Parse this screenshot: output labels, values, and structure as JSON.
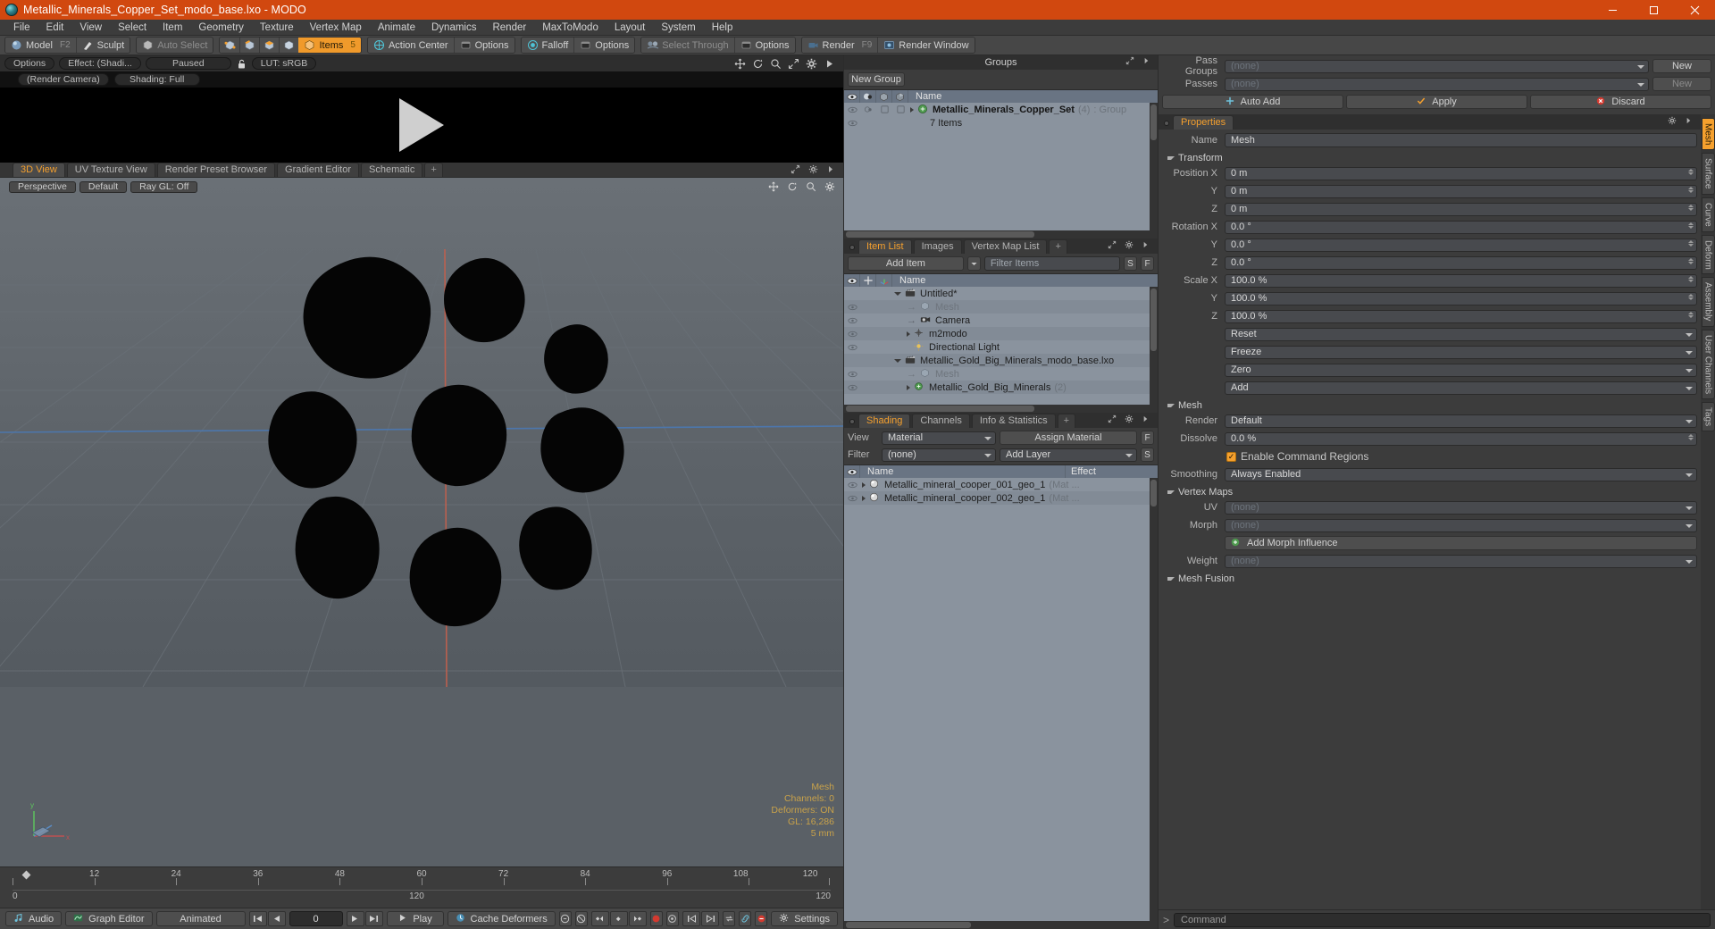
{
  "window": {
    "title": "Metallic_Minerals_Copper_Set_modo_base.lxo - MODO",
    "minimize": "─",
    "maximize": "❐",
    "close": "✕"
  },
  "menubar": [
    "File",
    "Edit",
    "View",
    "Select",
    "Item",
    "Geometry",
    "Texture",
    "Vertex Map",
    "Animate",
    "Dynamics",
    "Render",
    "MaxToModo",
    "Layout",
    "System",
    "Help"
  ],
  "toolbar": {
    "mode_model": "Model",
    "mode_model_key": "F2",
    "mode_sculpt": "Sculpt",
    "auto_select": "Auto Select",
    "items": "Items",
    "items_key": "5",
    "action_center": "Action Center",
    "options1": "Options",
    "falloff": "Falloff",
    "options2": "Options",
    "select_through": "Select Through",
    "options3": "Options",
    "render": "Render",
    "render_key": "F9",
    "render_window": "Render Window"
  },
  "preview": {
    "options": "Options",
    "effect": "Effect: (Shadi...",
    "paused": "Paused",
    "lut": "LUT: sRGB",
    "render_camera": "(Render Camera)",
    "shading": "Shading: Full"
  },
  "viewport_tabs": [
    {
      "label": "3D View",
      "active": true
    },
    {
      "label": "UV Texture View",
      "active": false
    },
    {
      "label": "Render Preset Browser",
      "active": false
    },
    {
      "label": "Gradient Editor",
      "active": false
    },
    {
      "label": "Schematic",
      "active": false
    },
    {
      "label": "+",
      "active": false
    }
  ],
  "viewport": {
    "perspective": "Perspective",
    "default": "Default",
    "raygl": "Ray GL: Off",
    "stats": {
      "title": "Mesh",
      "channels": "Channels: 0",
      "deformers": "Deformers: ON",
      "gl": "GL: 16,286",
      "size": "5 mm"
    },
    "axis_y": "y",
    "axis_x": "x",
    "axis_z": "z"
  },
  "timeline": {
    "ticks": [
      "0",
      "12",
      "24",
      "36",
      "48",
      "60",
      "72",
      "84",
      "96",
      "108",
      "120"
    ],
    "left_value": "0",
    "center_value": "120",
    "right_value": "120"
  },
  "statusbar": {
    "audio": "Audio",
    "graph_editor": "Graph Editor",
    "animated": "Animated",
    "frame": "0",
    "play": "Play",
    "cache_deformers": "Cache Deformers",
    "settings": "Settings"
  },
  "groups_panel": {
    "title": "Groups",
    "new_group": "New Group",
    "columns": [
      "eye",
      "shade",
      "render",
      "lock",
      "Name"
    ],
    "name_column": "Name",
    "rows": [
      {
        "name": "Metallic_Minerals_Copper_Set",
        "count": "(4)",
        "suffix": ": Group",
        "sub": "7 Items"
      }
    ]
  },
  "item_list_panel": {
    "tabs": [
      {
        "label": "Item List",
        "active": true
      },
      {
        "label": "Images",
        "active": false
      },
      {
        "label": "Vertex Map List",
        "active": false
      },
      {
        "label": "+",
        "active": false
      }
    ],
    "add_item": "Add Item",
    "filter_placeholder": "Filter Items",
    "btn_s": "S",
    "btn_f": "F",
    "name_column": "Name",
    "rows": [
      {
        "label": "Untitled*",
        "type": "scene",
        "depth": 0,
        "dim": false,
        "expander": "down"
      },
      {
        "label": "Mesh",
        "type": "mesh",
        "depth": 1,
        "dim": true,
        "expander": ""
      },
      {
        "label": "Camera",
        "type": "camera",
        "depth": 1,
        "dim": false,
        "expander": ""
      },
      {
        "label": "m2modo",
        "type": "locator",
        "depth": 1,
        "dim": false,
        "expander": "right"
      },
      {
        "label": "Directional Light",
        "type": "light",
        "depth": 1,
        "dim": false,
        "expander": ""
      },
      {
        "label": "Metallic_Gold_Big_Minerals_modo_base.lxo",
        "type": "scene",
        "depth": 0,
        "dim": false,
        "expander": "down"
      },
      {
        "label": "Mesh",
        "type": "mesh",
        "depth": 1,
        "dim": true,
        "expander": ""
      },
      {
        "label": "Metallic_Gold_Big_Minerals",
        "type": "group",
        "depth": 1,
        "dim": false,
        "expander": "right",
        "count": "(2)"
      }
    ]
  },
  "shading_panel": {
    "tabs": [
      {
        "label": "Shading",
        "active": true
      },
      {
        "label": "Channels",
        "active": false
      },
      {
        "label": "Info & Statistics",
        "active": false
      },
      {
        "label": "+",
        "active": false
      }
    ],
    "view_label": "View",
    "view_value": "Material",
    "assign_material": "Assign Material",
    "btn_f": "F",
    "filter_label": "Filter",
    "filter_value": "(none)",
    "add_layer": "Add Layer",
    "btn_s": "S",
    "col_name": "Name",
    "col_effect": "Effect",
    "rows": [
      {
        "name": "Metallic_mineral_cooper_001_geo_1",
        "suffix": "(Mat ..."
      },
      {
        "name": "Metallic_mineral_cooper_002_geo_1",
        "suffix": "(Mat ..."
      }
    ]
  },
  "passes_panel": {
    "pass_groups_label": "Pass Groups",
    "pass_groups_value": "(none)",
    "new_button": "New",
    "passes_label": "Passes",
    "passes_value": "(none)",
    "new_button2": "New",
    "auto_add": "Auto Add",
    "apply": "Apply",
    "discard": "Discard"
  },
  "properties": {
    "tab_label": "Properties",
    "name_label": "Name",
    "name_value": "Mesh",
    "sections": {
      "transform": "Transform",
      "mesh": "Mesh",
      "vertex_maps": "Vertex Maps",
      "mesh_fusion": "Mesh Fusion"
    },
    "transform": [
      {
        "label": "Position X",
        "value": "0 m"
      },
      {
        "label": "Y",
        "value": "0 m"
      },
      {
        "label": "Z",
        "value": "0 m"
      },
      {
        "label": "Rotation X",
        "value": "0.0 °"
      },
      {
        "label": "Y",
        "value": "0.0 °"
      },
      {
        "label": "Z",
        "value": "0.0 °"
      },
      {
        "label": "Scale X",
        "value": "100.0 %"
      },
      {
        "label": "Y",
        "value": "100.0 %"
      },
      {
        "label": "Z",
        "value": "100.0 %"
      }
    ],
    "transform_actions": [
      "Reset",
      "Freeze",
      "Zero",
      "Add"
    ],
    "mesh": [
      {
        "label": "Render",
        "value": "Default",
        "kind": "drop"
      },
      {
        "label": "Dissolve",
        "value": "0.0 %",
        "kind": "num"
      }
    ],
    "enable_command_regions": "Enable Command Regions",
    "smoothing_label": "Smoothing",
    "smoothing_value": "Always Enabled",
    "vertex_maps": [
      {
        "label": "UV",
        "value": "(none)"
      },
      {
        "label": "Morph",
        "value": "(none)"
      },
      {
        "label": "Weight",
        "value": "(none)"
      }
    ],
    "add_morph_influence": "Add Morph Influence",
    "vtabs": [
      {
        "label": "Mesh",
        "active": true
      },
      {
        "label": "Surface",
        "active": false
      },
      {
        "label": "Curve",
        "active": false
      },
      {
        "label": "Deform",
        "active": false
      },
      {
        "label": "Assembly",
        "active": false
      },
      {
        "label": "User Channels",
        "active": false
      },
      {
        "label": "Tags",
        "active": false
      }
    ]
  },
  "command": {
    "prompt": ">",
    "placeholder": "Command"
  },
  "colors": {
    "accent_orange": "#f5a02e",
    "title_bar": "#d1480f",
    "panel_bg": "#3c3c3c",
    "list_bg": "#8a939e",
    "list_header": "#697483",
    "viewport_bg": "#5a6066",
    "stats_text": "#c9a24a"
  }
}
